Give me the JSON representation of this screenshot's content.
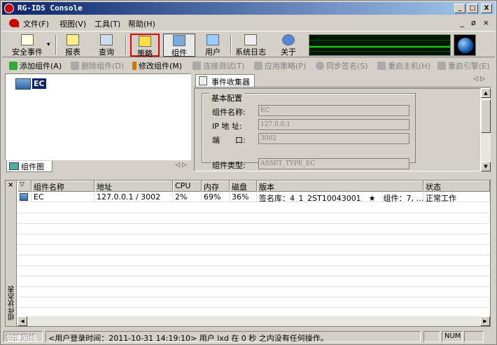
{
  "window": {
    "title": "RG-IDS Console",
    "btn_min": "_",
    "btn_max": "□",
    "btn_close": "X"
  },
  "menu": {
    "items": [
      "文件(F)",
      "视图(V)",
      "工具(T)",
      "帮助(H)"
    ],
    "mdi_min": "_",
    "mdi_restore": "ø",
    "mdi_close": "×"
  },
  "toolbar": {
    "buttons": [
      "安全事件",
      "报表",
      "查询",
      "策略",
      "组件",
      "用户",
      "系统日志",
      "关于"
    ],
    "dropdown": "▾"
  },
  "actions": {
    "items": [
      {
        "label": "添加组件(A)",
        "enabled": true
      },
      {
        "label": "删除组件(D)",
        "enabled": false
      },
      {
        "label": "修改组件(M)",
        "enabled": true
      },
      {
        "label": "连接测试(T)",
        "enabled": false
      },
      {
        "label": "应用策略(P)",
        "enabled": false
      },
      {
        "label": "同步签名(S)",
        "enabled": false
      },
      {
        "label": "重启主机(H)",
        "enabled": false
      },
      {
        "label": "重启引擎(E)",
        "enabled": false
      }
    ]
  },
  "tree": {
    "node": "EC",
    "tab_label": "组件图",
    "arrows": "◁ ▷"
  },
  "detail": {
    "tab_label": "事件收集器",
    "arrows": "◁ ▷",
    "group_label": "基本配置",
    "fields": [
      {
        "label": "组件名称:",
        "value": "EC"
      },
      {
        "label": "IP 地 址:",
        "value": "127.0.0.1"
      },
      {
        "label": "端　　口:",
        "value": "3002"
      },
      {
        "label": "组件类型:",
        "value": "ASSET_TYPE_EC"
      }
    ]
  },
  "table": {
    "side_label": "组件状态表",
    "close": "×",
    "filter_icon": "▽",
    "columns": [
      "组件名称",
      "地址",
      "CPU",
      "内存",
      "磁盘",
      "版本",
      "状态"
    ],
    "rows": [
      [
        "EC",
        "127.0.0.1 / 3002",
        "2%",
        "69%",
        "36%",
        "签名库：4_1_2ST10043001　★　组件：7, ...",
        "正常工作"
      ]
    ]
  },
  "status": {
    "brand": "锐捷网络",
    "message": "<用户登录时间：2011-10-31 14:19:10> 用户 lxd 在 0 秒 之内没有任何操作。",
    "num": "NUM"
  },
  "colors": {
    "titlebar": "#0a246a",
    "highlight": "#dd0000",
    "monitor_line": "#18d018"
  }
}
